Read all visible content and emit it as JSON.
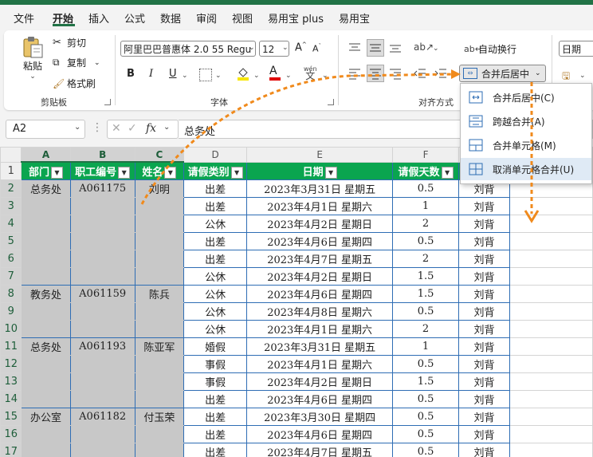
{
  "menu": {
    "items": [
      "文件",
      "开始",
      "插入",
      "公式",
      "数据",
      "审阅",
      "视图",
      "易用宝 plus",
      "易用宝"
    ],
    "active": "开始"
  },
  "ribbon": {
    "clipboard": {
      "paste": "粘贴",
      "cut": "剪切",
      "copy": "复制",
      "format_painter": "格式刷",
      "group_label": "剪贴板"
    },
    "font": {
      "font_name": "阿里巴巴普惠体 2.0 55 Regu",
      "font_size": "12",
      "bold": "B",
      "italic": "I",
      "underline": "U",
      "phonetic": "wén",
      "group_label": "字体"
    },
    "alignment": {
      "wrap_text": "自动换行",
      "merge_center": "合并后居中",
      "group_label": "对齐方式"
    },
    "number": {
      "format": "日期"
    }
  },
  "formula_bar": {
    "name_box": "A2",
    "fx": "fx",
    "value": "总务处"
  },
  "merge_menu": {
    "items": [
      "合并后居中(C)",
      "跨越合并(A)",
      "合并单元格(M)",
      "取消单元格合并(U)"
    ],
    "hovered_index": 3
  },
  "sheet": {
    "columns": [
      "A",
      "B",
      "C",
      "D",
      "E",
      "F",
      "G"
    ],
    "headers": [
      "部门",
      "职工编号",
      "姓名",
      "请假类别",
      "日期",
      "请假天数",
      "审批人"
    ],
    "rows": [
      {
        "n": "2",
        "dept": "总务处",
        "id": "A061175",
        "name": "刘明",
        "type": "出差",
        "date": "2023年3月31日  星期五",
        "days": "0.5",
        "approver": "刘背"
      },
      {
        "n": "3",
        "dept": "",
        "id": "",
        "name": "",
        "type": "出差",
        "date": "2023年4月1日  星期六",
        "days": "1",
        "approver": "刘背"
      },
      {
        "n": "4",
        "dept": "",
        "id": "",
        "name": "",
        "type": "公休",
        "date": "2023年4月2日  星期日",
        "days": "2",
        "approver": "刘背"
      },
      {
        "n": "5",
        "dept": "",
        "id": "",
        "name": "",
        "type": "出差",
        "date": "2023年4月6日  星期四",
        "days": "0.5",
        "approver": "刘背"
      },
      {
        "n": "6",
        "dept": "",
        "id": "",
        "name": "",
        "type": "出差",
        "date": "2023年4月7日  星期五",
        "days": "2",
        "approver": "刘背"
      },
      {
        "n": "7",
        "dept": "",
        "id": "",
        "name": "",
        "type": "公休",
        "date": "2023年4月2日  星期日",
        "days": "1.5",
        "approver": "刘背"
      },
      {
        "n": "8",
        "dept": "教务处",
        "id": "A061159",
        "name": "陈兵",
        "type": "公休",
        "date": "2023年4月6日  星期四",
        "days": "1.5",
        "approver": "刘背"
      },
      {
        "n": "9",
        "dept": "",
        "id": "",
        "name": "",
        "type": "公休",
        "date": "2023年4月8日  星期六",
        "days": "0.5",
        "approver": "刘背"
      },
      {
        "n": "10",
        "dept": "",
        "id": "",
        "name": "",
        "type": "公休",
        "date": "2023年4月1日  星期六",
        "days": "2",
        "approver": "刘背"
      },
      {
        "n": "11",
        "dept": "总务处",
        "id": "A061193",
        "name": "陈亚军",
        "type": "婚假",
        "date": "2023年3月31日  星期五",
        "days": "1",
        "approver": "刘背"
      },
      {
        "n": "12",
        "dept": "",
        "id": "",
        "name": "",
        "type": "事假",
        "date": "2023年4月1日  星期六",
        "days": "0.5",
        "approver": "刘背"
      },
      {
        "n": "13",
        "dept": "",
        "id": "",
        "name": "",
        "type": "事假",
        "date": "2023年4月2日  星期日",
        "days": "1.5",
        "approver": "刘背"
      },
      {
        "n": "14",
        "dept": "",
        "id": "",
        "name": "",
        "type": "出差",
        "date": "2023年4月6日  星期四",
        "days": "0.5",
        "approver": "刘背"
      },
      {
        "n": "15",
        "dept": "办公室",
        "id": "A061182",
        "name": "付玉荣",
        "type": "出差",
        "date": "2023年3月30日  星期四",
        "days": "0.5",
        "approver": "刘背"
      },
      {
        "n": "16",
        "dept": "",
        "id": "",
        "name": "",
        "type": "出差",
        "date": "2023年4月6日  星期四",
        "days": "0.5",
        "approver": "刘背"
      },
      {
        "n": "17",
        "dept": "",
        "id": "",
        "name": "",
        "type": "出差",
        "date": "2023年4月7日  星期五",
        "days": "0.5",
        "approver": "刘背"
      }
    ]
  },
  "colors": {
    "accent": "#217346",
    "header_fill": "#0aa54f",
    "annotation": "#f08a1c",
    "cell_border": "#2e6db4"
  }
}
